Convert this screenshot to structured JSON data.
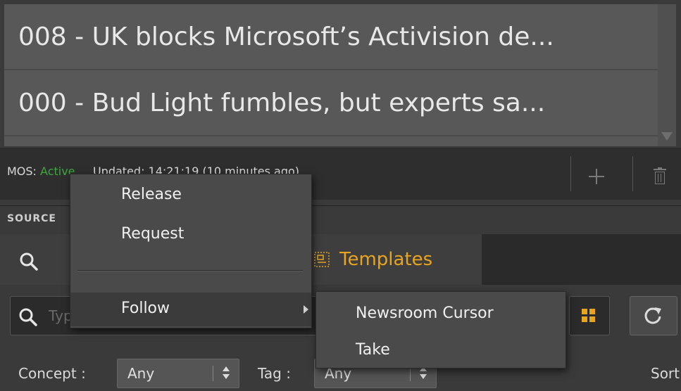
{
  "stories": [
    {
      "label": "008 - UK blocks Microsoft’s Activision de..."
    },
    {
      "label": "000 - Bud Light fumbles, but experts sa..."
    }
  ],
  "status_bar": {
    "mos_prefix": "MOS: ",
    "mos_state": "Active",
    "updated_text": "Updated: 14:21:19 (10 minutes ago)"
  },
  "source": {
    "header": "SOURCE"
  },
  "tabs": {
    "templates_label": "Templates"
  },
  "search": {
    "placeholder": "Type to search"
  },
  "filters": {
    "concept_label": "Concept :",
    "concept_value": "Any",
    "tag_label": "Tag :",
    "tag_value": "Any",
    "sort_label": "Sort"
  },
  "context_menu": {
    "items": [
      {
        "label": "Release"
      },
      {
        "label": "Request"
      },
      {
        "label": "Follow"
      }
    ]
  },
  "submenu": {
    "items": [
      {
        "label": "Newsroom Cursor"
      },
      {
        "label": "Take"
      }
    ]
  },
  "colors": {
    "accent": "#e8a41e",
    "active": "#3fa63f"
  }
}
